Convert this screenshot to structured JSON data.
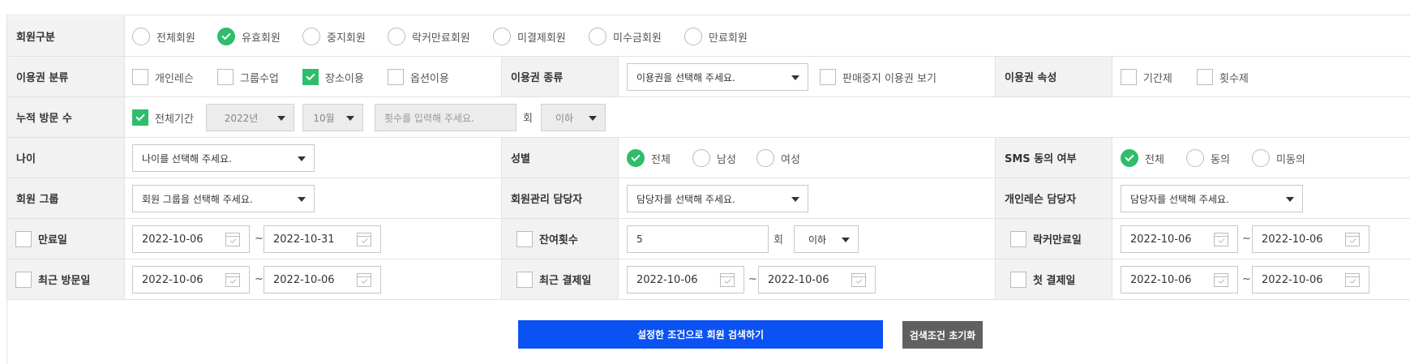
{
  "membership": {
    "label": "회원구분",
    "options": [
      {
        "label": "전체회원",
        "checked": false
      },
      {
        "label": "유효회원",
        "checked": true
      },
      {
        "label": "중지회원",
        "checked": false
      },
      {
        "label": "락커만료회원",
        "checked": false
      },
      {
        "label": "미결제회원",
        "checked": false
      },
      {
        "label": "미수금회원",
        "checked": false
      },
      {
        "label": "만료회원",
        "checked": false
      }
    ]
  },
  "pass_category": {
    "label": "이용권 분류",
    "options": [
      {
        "label": "개인레슨",
        "checked": false
      },
      {
        "label": "그룹수업",
        "checked": false
      },
      {
        "label": "장소이용",
        "checked": true
      },
      {
        "label": "옵션이용",
        "checked": false
      }
    ]
  },
  "pass_type": {
    "label": "이용권 종류",
    "select_value": "이용권을 선택해 주세요.",
    "discontinued_label": "판매중지 이용권 보기",
    "discontinued_checked": false
  },
  "pass_attr": {
    "label": "이용권 속성",
    "options": [
      {
        "label": "기간제",
        "checked": false
      },
      {
        "label": "횟수제",
        "checked": false
      }
    ]
  },
  "visits": {
    "label": "누적 방문 수",
    "all_period_label": "전체기간",
    "all_period_checked": true,
    "year": "2022년",
    "month": "10월",
    "count_placeholder": "횟수를 입력해 주세요.",
    "unit": "회",
    "condition": "이하"
  },
  "age": {
    "label": "나이",
    "select_value": "나이를 선택해 주세요."
  },
  "gender": {
    "label": "성별",
    "options": [
      {
        "label": "전체",
        "checked": true
      },
      {
        "label": "남성",
        "checked": false
      },
      {
        "label": "여성",
        "checked": false
      }
    ]
  },
  "sms": {
    "label": "SMS 동의 여부",
    "options": [
      {
        "label": "전체",
        "checked": true
      },
      {
        "label": "동의",
        "checked": false
      },
      {
        "label": "미동의",
        "checked": false
      }
    ]
  },
  "member_group": {
    "label": "회원 그룹",
    "select_value": "회원 그룹을 선택해 주세요."
  },
  "manager": {
    "label": "회원관리 담당자",
    "select_value": "담당자를 선택해 주세요."
  },
  "lesson_manager": {
    "label": "개인레슨 담당자",
    "select_value": "담당자를 선택해 주세요."
  },
  "expiry": {
    "label": "만료일",
    "checked": false,
    "from": "2022-10-06",
    "to": "2022-10-31"
  },
  "remaining": {
    "label": "잔여횟수",
    "checked": false,
    "value": "5",
    "unit": "회",
    "condition": "이하"
  },
  "locker_expiry": {
    "label": "락커만료일",
    "checked": false,
    "from": "2022-10-06",
    "to": "2022-10-06"
  },
  "last_visit": {
    "label": "최근 방문일",
    "checked": false,
    "from": "2022-10-06",
    "to": "2022-10-06"
  },
  "last_payment": {
    "label": "최근 결제일",
    "checked": false,
    "from": "2022-10-06",
    "to": "2022-10-06"
  },
  "first_payment": {
    "label": "첫 결제일",
    "checked": false,
    "from": "2022-10-06",
    "to": "2022-10-06"
  },
  "tilde": "~",
  "actions": {
    "search": "설정한 조건으로 회원 검색하기",
    "reset": "검색조건 초기화"
  },
  "colors": {
    "check_on": "#2ebd6a",
    "primary": "#0b52f2",
    "reset": "#606060",
    "label_bg": "#f2f2f2"
  }
}
